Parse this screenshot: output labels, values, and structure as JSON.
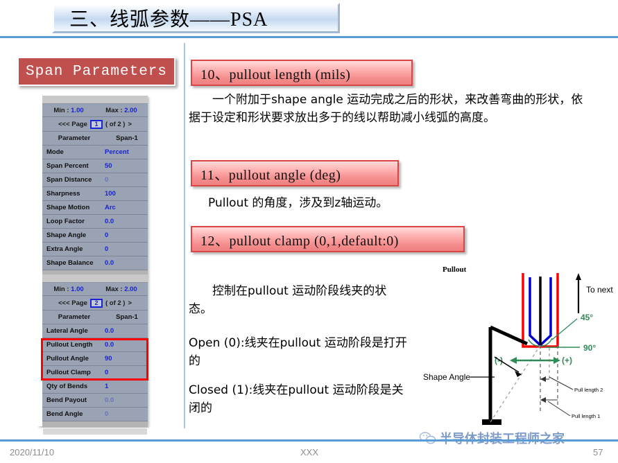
{
  "slide": {
    "title": "三、线弧参数——PSA",
    "footer": {
      "date": "2020/11/10",
      "center": "XXX",
      "page": "57"
    },
    "watermark": {
      "text": "半导体封装工程师之家",
      "icon": "wechat-icon"
    }
  },
  "left_panel": {
    "badge": "Span  Parameters",
    "tables": [
      {
        "min_label": "Min :",
        "min_value": "1.00",
        "max_label": "Max :",
        "max_value": "2.00",
        "page_prev": "<<< Page",
        "page_value": "1",
        "page_of": "( of 2 )",
        "page_next": ">",
        "col1_header": "Parameter",
        "col2_header": "Span-1",
        "rows": [
          {
            "name": "Mode",
            "value": "Percent",
            "dim": false
          },
          {
            "name": "Span Percent",
            "value": "50",
            "dim": false
          },
          {
            "name": "Span Distance",
            "value": "0",
            "dim": true
          },
          {
            "name": "Sharpness",
            "value": "100",
            "dim": false
          },
          {
            "name": "Shape Motion",
            "value": "Arc",
            "dim": false
          },
          {
            "name": "Loop Factor",
            "value": "0.0",
            "dim": false
          },
          {
            "name": "Shape Angle",
            "value": "0",
            "dim": false
          },
          {
            "name": "Extra Angle",
            "value": "0",
            "dim": false
          },
          {
            "name": "Shape Balance",
            "value": "0.0",
            "dim": false
          }
        ]
      },
      {
        "min_label": "Min :",
        "min_value": "1.00",
        "max_label": "Max :",
        "max_value": "2.00",
        "page_prev": "<<< Page",
        "page_value": "2",
        "page_of": "( of 2 )",
        "page_next": ">",
        "col1_header": "Parameter",
        "col2_header": "Span-1",
        "rows": [
          {
            "name": "Lateral Angle",
            "value": "0.0",
            "dim": false
          },
          {
            "name": "Pullout Length",
            "value": "0.0",
            "dim": false
          },
          {
            "name": "Pullout Angle",
            "value": "90",
            "dim": false
          },
          {
            "name": "Pullout Clamp",
            "value": "0",
            "dim": false
          },
          {
            "name": "Qty of Bends",
            "value": "1",
            "dim": false
          },
          {
            "name": "Bend Payout",
            "value": "0.0",
            "dim": true
          },
          {
            "name": "Bend Angle",
            "value": "0",
            "dim": true
          }
        ]
      }
    ],
    "highlight_color": "#ff0000"
  },
  "content": {
    "heading_10": "10、pullout length (mils)",
    "paragraph_10": "一个附加于shape angle 运动完成之后的形状，来改善弯曲的形状，依据于设定和形状要求放出多于的线以帮助减小线弧的高度。",
    "heading_11": "11、pullout angle (deg)",
    "paragraph_11": "Pullout 的角度，涉及到z轴运动。",
    "heading_12": "12、pullout clamp (0,1,default:0)",
    "paragraph_12a": "控制在pullout 运动阶段线夹的状态。",
    "paragraph_12b": "Open (0):线夹在pullout 运动阶段是打开的",
    "paragraph_12c": "Closed (1):线夹在pullout 运动阶段是关闭的"
  },
  "diagram": {
    "labels": {
      "pullout": "Pullout",
      "to_next_span": "To next Span",
      "angle_45": "45°",
      "angle_90": "90°",
      "minus": "(-)",
      "plus": "(+)",
      "shape_angle": "Shape Angle",
      "pull_length_2": "Pull length 2",
      "pull_length_1": "Pull length 1"
    },
    "colors": {
      "outer_loop": "#ff0000",
      "inner_loop": "#0000cd",
      "wire": "#000000",
      "annotation": "#2e8b57"
    }
  }
}
